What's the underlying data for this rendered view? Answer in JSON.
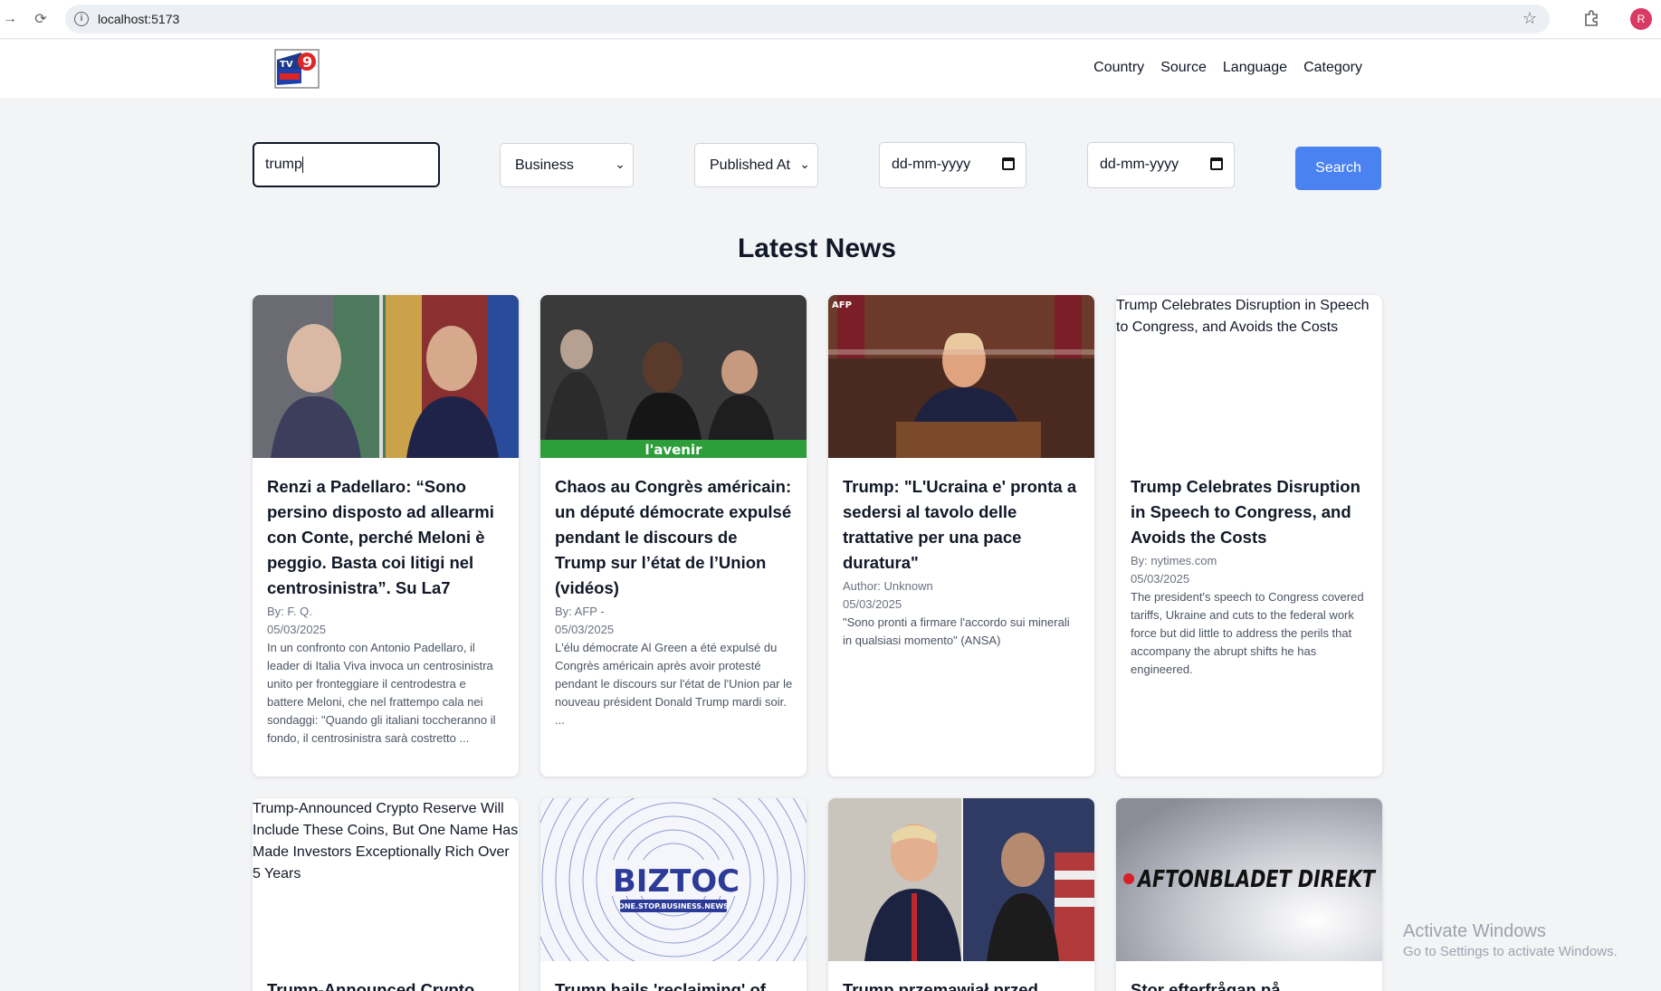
{
  "browser": {
    "url": "localhost:5173",
    "profile_initial": "R"
  },
  "nav": {
    "items": [
      "Country",
      "Source",
      "Language",
      "Category"
    ]
  },
  "filters": {
    "search_value": "trump",
    "category_selected": "Business",
    "sort_selected": "Published At",
    "date_from_placeholder": "dd-mm-yyyy",
    "date_to_placeholder": "dd-mm-yyyy",
    "search_label": "Search"
  },
  "heading": "Latest News",
  "cards": [
    {
      "title": "Renzi a Padellaro: “Sono persino disposto ad allearmi con Conte, perché Meloni è peggio. Basta coi litigi nel centrosinistra”. Su La7",
      "author": "By: F. Q.",
      "date": "05/03/2025",
      "description": "In un confronto con Antonio Padellaro, il leader di Italia Viva invoca un centrosinistra unito per fronteggiare il centrodestra e battere Meloni, che nel frattempo cala nei sondaggi: \"Quando gli italiani toccheranno il fondo, il centrosinistra sarà costretto ..."
    },
    {
      "title": "Chaos au Congrès américain: un député démocrate expulsé pendant le discours de Trump sur l’état de l’Union (vidéos)",
      "author": "By: AFP -",
      "date": "05/03/2025",
      "description": "L'élu démocrate Al Green a été expulsé du Congrès américain après avoir protesté pendant le discours sur l'état de l'Union par le nouveau président Donald Trump mardi soir. ...",
      "image_label": "l'avenir"
    },
    {
      "title": "Trump: \"L'Ucraina e' pronta a sedersi al tavolo delle trattative per una pace duratura\"",
      "author": "Author: Unknown",
      "date": "05/03/2025",
      "description": "\"Sono pronti a firmare l'accordo sui minerali in qualsiasi momento\" (ANSA)",
      "image_label": "AFP"
    },
    {
      "title": "Trump Celebrates Disruption in Speech to Congress, and Avoids the Costs",
      "author": "By: nytimes.com",
      "date": "05/03/2025",
      "description": "The president's speech to Congress covered tariffs, Ukraine and cuts to the federal work force but did little to address the perils that accompany the abrupt shifts he has engineered.",
      "image_alt": "Trump Celebrates Disruption in Speech to Congress, and Avoids the Costs"
    },
    {
      "title": "Trump-Announced Crypto",
      "image_alt": "Trump-Announced Crypto Reserve Will Include These Coins, But One Name Has Made Investors Exceptionally Rich Over 5 Years"
    },
    {
      "title": "Trump hails 'reclaiming' of",
      "image_label": "BIZTOC",
      "image_sublabel": "ONE.STOP.BUSINESS.NEWS"
    },
    {
      "title": "Trump przemawiał przed"
    },
    {
      "title": "Stor efterfrågan på utbildningar",
      "image_label": "AFTONBLADET DIREKT"
    }
  ],
  "watermark": {
    "line1": "Activate Windows",
    "line2": "Go to Settings to activate Windows."
  }
}
